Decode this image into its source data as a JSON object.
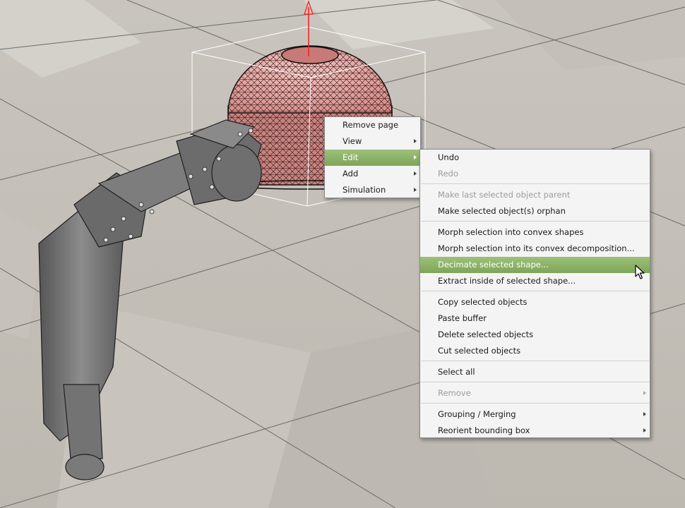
{
  "context_menu": {
    "items": [
      {
        "label": "Remove page",
        "has_submenu": false,
        "state": "normal"
      },
      {
        "label": "View",
        "has_submenu": true,
        "state": "normal"
      },
      {
        "label": "Edit",
        "has_submenu": true,
        "state": "active"
      },
      {
        "label": "Add",
        "has_submenu": true,
        "state": "normal"
      },
      {
        "label": "Simulation",
        "has_submenu": true,
        "state": "normal"
      }
    ]
  },
  "edit_submenu": {
    "items": [
      {
        "label": "Undo",
        "state": "normal"
      },
      {
        "label": "Redo",
        "state": "disabled"
      },
      {
        "label": "Make last selected object parent",
        "state": "disabled"
      },
      {
        "label": "Make selected object(s) orphan",
        "state": "normal"
      },
      {
        "label": "Morph selection into convex shapes",
        "state": "normal"
      },
      {
        "label": "Morph selection into its convex decomposition...",
        "state": "normal"
      },
      {
        "label": "Decimate selected shape...",
        "state": "highlighted"
      },
      {
        "label": "Extract inside of selected shape...",
        "state": "normal"
      },
      {
        "label": "Copy selected objects",
        "state": "normal"
      },
      {
        "label": "Paste buffer",
        "state": "normal"
      },
      {
        "label": "Delete selected objects",
        "state": "normal"
      },
      {
        "label": "Cut selected objects",
        "state": "normal"
      },
      {
        "label": "Select all",
        "state": "normal"
      },
      {
        "label": "Remove",
        "state": "disabled",
        "has_submenu": true
      },
      {
        "label": "Grouping / Merging",
        "state": "normal",
        "has_submenu": true
      },
      {
        "label": "Reorient bounding box",
        "state": "normal",
        "has_submenu": true
      }
    ]
  },
  "viewport": {
    "floor_light": "#d3d0ca",
    "floor_dark": "#b3afa7",
    "selected_shape_color": "#e8a3a0",
    "robot_color": "#6f6f6f",
    "bbox_color": "#ffffff",
    "axis_color": "#ff1a1a"
  },
  "colors": {
    "highlight": "#85ab60",
    "menu_bg": "#f4f4f4",
    "disabled_text": "#9c9c9c"
  }
}
